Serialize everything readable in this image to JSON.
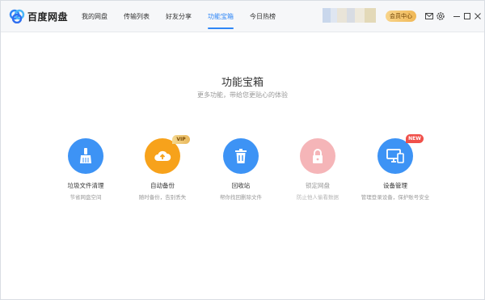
{
  "app": {
    "title": "百度网盘",
    "logo_icon": "baidu-netdisk-logo"
  },
  "nav": {
    "items": [
      {
        "label": "我的网盘"
      },
      {
        "label": "传输列表"
      },
      {
        "label": "好友分享"
      },
      {
        "label": "功能宝箱",
        "active": true
      },
      {
        "label": "今日热榜"
      }
    ]
  },
  "topbar": {
    "vip_center": "会员中心",
    "icons": [
      "mail-icon",
      "settings-icon",
      "minimize-icon",
      "maximize-icon",
      "close-icon"
    ]
  },
  "main": {
    "title": "功能宝箱",
    "subtitle": "更多功能，带给您更贴心的体验",
    "tools": [
      {
        "name": "垃圾文件清理",
        "desc": "节省网盘空间",
        "icon": "broom-icon",
        "color": "#3d93f5"
      },
      {
        "name": "自动备份",
        "desc": "随时备份，告别丢失",
        "icon": "cloud-upload-icon",
        "color": "#f7a21b",
        "badge": "VIP"
      },
      {
        "name": "回收站",
        "desc": "帮你找回删除文件",
        "icon": "trash-icon",
        "color": "#3d93f5"
      },
      {
        "name": "锁定网盘",
        "desc": "防止他人偷看数据",
        "icon": "lock-icon",
        "color": "#f5b5b8"
      },
      {
        "name": "设备管理",
        "desc": "管理登录设备，保护账号安全",
        "icon": "devices-icon",
        "color": "#3d93f5",
        "badge": "NEW"
      }
    ]
  }
}
